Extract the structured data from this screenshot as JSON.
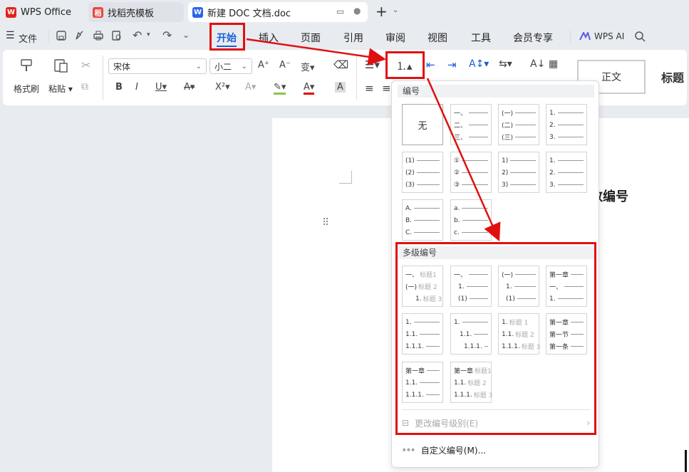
{
  "tabs": [
    {
      "label": "WPS Office",
      "icon": "wps-logo-icon"
    },
    {
      "label": "找稻壳模板",
      "icon": "docer-icon"
    },
    {
      "label": "新建 DOC 文档.doc",
      "icon": "word-doc-icon"
    }
  ],
  "menu": {
    "file": "文件",
    "items": [
      "开始",
      "插入",
      "页面",
      "引用",
      "审阅",
      "视图",
      "工具",
      "会员专享"
    ],
    "wps_ai": "WPS AI"
  },
  "ribbon": {
    "format_painter": "格式刷",
    "paste": "粘贴",
    "font_name": "宋体",
    "font_size": "小二",
    "bold": "B",
    "italic": "I",
    "underline": "U",
    "styles": [
      "正文",
      "标题"
    ]
  },
  "doc": {
    "heading_fragment": "数编号"
  },
  "dropdown": {
    "numbering_title": "编号",
    "none_label": "无",
    "numbering": [
      {
        "lines": [
          "一、",
          "二、",
          "三、"
        ]
      },
      {
        "lines": [
          "(一)",
          "(二)",
          "(三)"
        ]
      },
      {
        "lines": [
          "1.",
          "2.",
          "3."
        ]
      },
      {
        "lines": [
          "(1)",
          "(2)",
          "(3)"
        ]
      },
      {
        "lines": [
          "①",
          "②",
          "③"
        ]
      },
      {
        "lines": [
          "1)",
          "2)",
          "3)"
        ]
      },
      {
        "lines": [
          "1.",
          "2.",
          "3."
        ]
      },
      {
        "lines": [
          "A.",
          "B.",
          "C."
        ]
      },
      {
        "lines": [
          "a.",
          "b.",
          "c."
        ]
      }
    ],
    "multilevel_title": "多级编号",
    "multilevel": [
      {
        "lines": [
          [
            "一、",
            "标题1"
          ],
          [
            "(一)",
            "标题 2"
          ],
          [
            "1.",
            "标题 3"
          ]
        ]
      },
      {
        "lines": [
          [
            "一、",
            ""
          ],
          [
            "1.",
            ""
          ],
          [
            "(1)",
            ""
          ]
        ]
      },
      {
        "lines": [
          [
            "(一)",
            ""
          ],
          [
            "1.",
            ""
          ],
          [
            "(1)",
            ""
          ]
        ]
      },
      {
        "lines": [
          [
            "第一章",
            ""
          ],
          [
            "一、",
            ""
          ],
          [
            "1.",
            ""
          ]
        ]
      },
      {
        "lines": [
          [
            "1.",
            ""
          ],
          [
            "1.1.",
            ""
          ],
          [
            "1.1.1.",
            ""
          ]
        ]
      },
      {
        "lines": [
          [
            "1.",
            ""
          ],
          [
            "1.1.",
            ""
          ],
          [
            "1.1.1.",
            ""
          ]
        ]
      },
      {
        "lines": [
          [
            "1.",
            "标题 1"
          ],
          [
            "1.1.",
            "标题 2"
          ],
          [
            "1.1.1.",
            "标题 3"
          ]
        ]
      },
      {
        "lines": [
          [
            "第一章",
            ""
          ],
          [
            "第一节",
            ""
          ],
          [
            "第一条",
            ""
          ]
        ]
      },
      {
        "lines": [
          [
            "第一章",
            ""
          ],
          [
            "1.1.",
            ""
          ],
          [
            "1.1.1.",
            ""
          ]
        ]
      },
      {
        "lines": [
          [
            "第一章",
            "标题1"
          ],
          [
            "1.1.",
            "标题 2"
          ],
          [
            "1.1.1.",
            "标题 3"
          ]
        ]
      }
    ],
    "change_level": "更改编号级别(E)",
    "custom": "自定义编号(M)..."
  }
}
